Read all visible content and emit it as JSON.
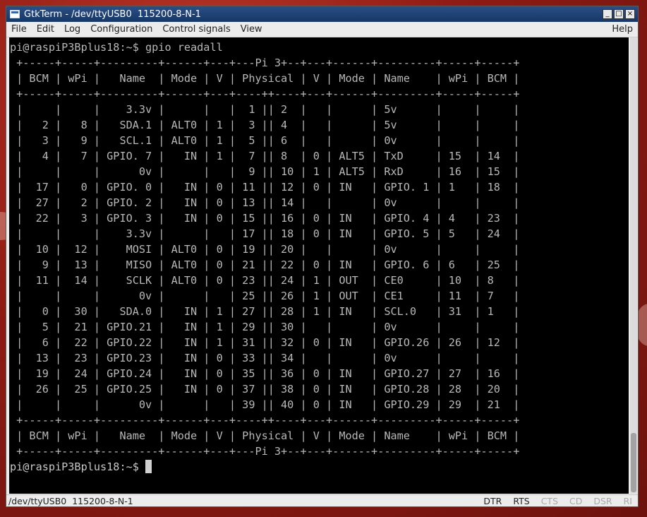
{
  "window": {
    "title": "GtkTerm - /dev/ttyUSB0  115200-8-N-1"
  },
  "titlebar_buttons": {
    "minimize": "_",
    "maximize": "□",
    "close": "×"
  },
  "menu": [
    "File",
    "Edit",
    "Log",
    "Configuration",
    "Control signals",
    "View"
  ],
  "menu_help": "Help",
  "terminal": {
    "lines": [
      "pi@raspiP3Bplus18:~$ gpio readall",
      " +-----+-----+---------+------+---+---Pi 3+--+---+------+---------+-----+-----+",
      " | BCM | wPi |   Name  | Mode | V | Physical | V | Mode | Name    | wPi | BCM |",
      " +-----+-----+---------+------+---+----++----+---+------+---------+-----+-----+",
      " |     |     |    3.3v |      |   |  1 || 2  |   |      | 5v      |     |     |",
      " |   2 |   8 |   SDA.1 | ALT0 | 1 |  3 || 4  |   |      | 5v      |     |     |",
      " |   3 |   9 |   SCL.1 | ALT0 | 1 |  5 || 6  |   |      | 0v      |     |     |",
      " |   4 |   7 | GPIO. 7 |   IN | 1 |  7 || 8  | 0 | ALT5 | TxD     | 15  | 14  |",
      " |     |     |      0v |      |   |  9 || 10 | 1 | ALT5 | RxD     | 16  | 15  |",
      " |  17 |   0 | GPIO. 0 |   IN | 0 | 11 || 12 | 0 | IN   | GPIO. 1 | 1   | 18  |",
      " |  27 |   2 | GPIO. 2 |   IN | 0 | 13 || 14 |   |      | 0v      |     |     |",
      " |  22 |   3 | GPIO. 3 |   IN | 0 | 15 || 16 | 0 | IN   | GPIO. 4 | 4   | 23  |",
      " |     |     |    3.3v |      |   | 17 || 18 | 0 | IN   | GPIO. 5 | 5   | 24  |",
      " |  10 |  12 |    MOSI | ALT0 | 0 | 19 || 20 |   |      | 0v      |     |     |",
      " |   9 |  13 |    MISO | ALT0 | 0 | 21 || 22 | 0 | IN   | GPIO. 6 | 6   | 25  |",
      " |  11 |  14 |    SCLK | ALT0 | 0 | 23 || 24 | 1 | OUT  | CE0     | 10  | 8   |",
      " |     |     |      0v |      |   | 25 || 26 | 1 | OUT  | CE1     | 11  | 7   |",
      " |   0 |  30 |   SDA.0 |   IN | 1 | 27 || 28 | 1 | IN   | SCL.0   | 31  | 1   |",
      " |   5 |  21 | GPIO.21 |   IN | 1 | 29 || 30 |   |      | 0v      |     |     |",
      " |   6 |  22 | GPIO.22 |   IN | 1 | 31 || 32 | 0 | IN   | GPIO.26 | 26  | 12  |",
      " |  13 |  23 | GPIO.23 |   IN | 0 | 33 || 34 |   |      | 0v      |     |     |",
      " |  19 |  24 | GPIO.24 |   IN | 0 | 35 || 36 | 0 | IN   | GPIO.27 | 27  | 16  |",
      " |  26 |  25 | GPIO.25 |   IN | 0 | 37 || 38 | 0 | IN   | GPIO.28 | 28  | 20  |",
      " |     |     |      0v |      |   | 39 || 40 | 0 | IN   | GPIO.29 | 29  | 21  |",
      " +-----+-----+---------+------+---+----++----+---+------+---------+-----+-----+",
      " | BCM | wPi |   Name  | Mode | V | Physical | V | Mode | Name    | wPi | BCM |",
      " +-----+-----+---------+------+---+---Pi 3+--+---+------+---------+-----+-----+"
    ],
    "prompt": "pi@raspiP3Bplus18:~$ "
  },
  "status": {
    "port": "/dev/ttyUSB0  115200-8-N-1",
    "signals": [
      {
        "label": "DTR",
        "active": true
      },
      {
        "label": "RTS",
        "active": true
      },
      {
        "label": "CTS",
        "active": false
      },
      {
        "label": "CD",
        "active": false
      },
      {
        "label": "DSR",
        "active": false
      },
      {
        "label": "RI",
        "active": false
      }
    ]
  },
  "colors": {
    "terminal_bg": "#000000",
    "terminal_fg": "#b8b8b8",
    "titlebar": "#1f4479"
  }
}
